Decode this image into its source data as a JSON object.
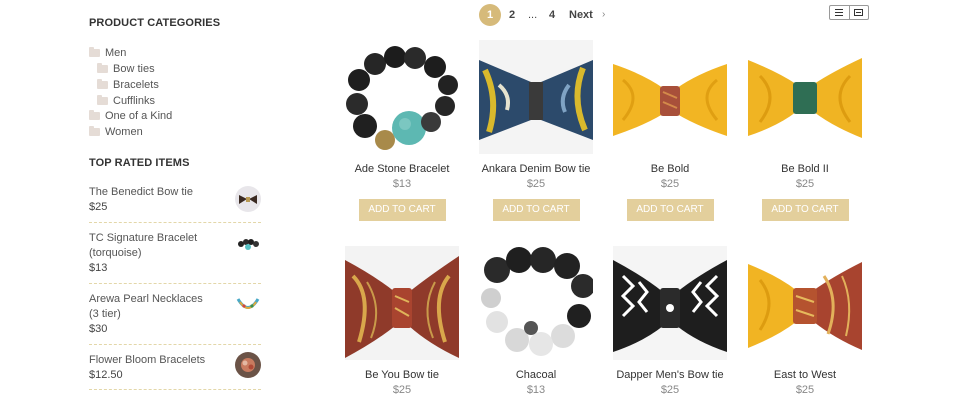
{
  "sidebar": {
    "categories_heading": "PRODUCT CATEGORIES",
    "categories": [
      {
        "label": "Men",
        "level": 0
      },
      {
        "label": "Bow ties",
        "level": 1
      },
      {
        "label": "Bracelets",
        "level": 1
      },
      {
        "label": "Cufflinks",
        "level": 1
      },
      {
        "label": "One of a Kind",
        "level": 0
      },
      {
        "label": "Women",
        "level": 0
      }
    ],
    "top_rated_heading": "TOP RATED ITEMS",
    "top_rated": [
      {
        "name": "The Benedict Bow tie",
        "price": "$25"
      },
      {
        "name": "TC Signature Bracelet (torquoise)",
        "price": "$13"
      },
      {
        "name": "Arewa Pearl Necklaces (3 tier)",
        "price": "$30"
      },
      {
        "name": "Flower Bloom Bracelets",
        "price": "$12.50"
      }
    ]
  },
  "pagination": {
    "current": "1",
    "page2": "2",
    "ellipsis": "...",
    "last": "4",
    "next": "Next",
    "next_arrow": "›"
  },
  "view_toggle": {
    "list_icon": "list-view-icon",
    "grid_icon": "grid-view-icon"
  },
  "products": [
    {
      "name": "Ade Stone Bracelet",
      "price": "$13",
      "cta": "ADD TO CART"
    },
    {
      "name": "Ankara Denim Bow tie",
      "price": "$25",
      "cta": "ADD TO CART"
    },
    {
      "name": "Be Bold",
      "price": "$25",
      "cta": "ADD TO CART"
    },
    {
      "name": "Be Bold II",
      "price": "$25",
      "cta": "ADD TO CART"
    },
    {
      "name": "Be You Bow tie",
      "price": "$25"
    },
    {
      "name": "Chacoal",
      "price": "$13"
    },
    {
      "name": "Dapper Men's Bow tie",
      "price": "$25"
    },
    {
      "name": "East to West",
      "price": "$25"
    }
  ],
  "colors": {
    "accent": "#d6ba7a",
    "button": "#e3cf9c",
    "separator": "#e3d7a9"
  }
}
